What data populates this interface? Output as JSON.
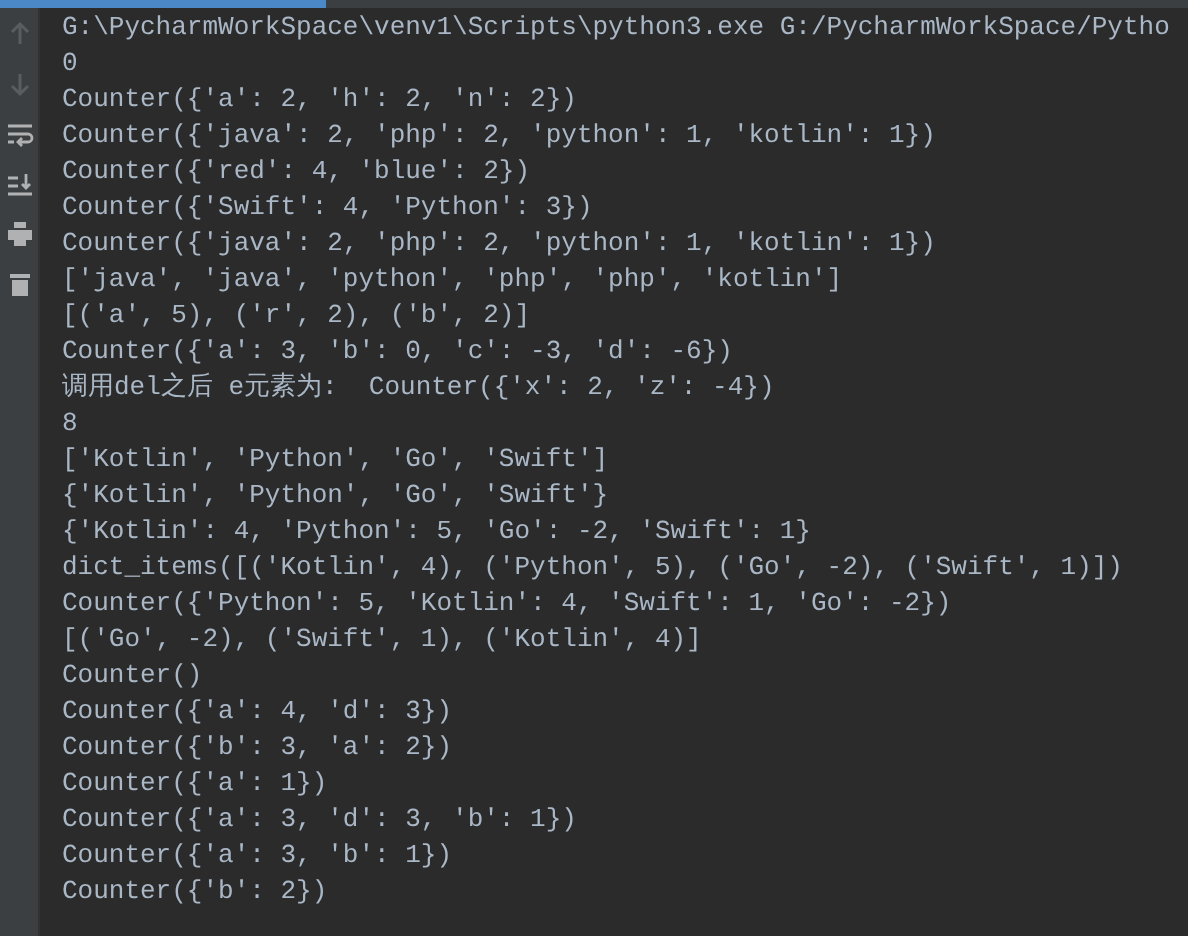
{
  "toolbar": [
    {
      "kind": "up",
      "disabled": true
    },
    {
      "kind": "down",
      "disabled": true
    },
    {
      "kind": "wrap",
      "disabled": false
    },
    {
      "kind": "scroll-end",
      "disabled": false
    },
    {
      "kind": "print",
      "disabled": false
    },
    {
      "kind": "trash",
      "disabled": false
    }
  ],
  "console": {
    "lines": [
      "G:\\PycharmWorkSpace\\venv1\\Scripts\\python3.exe G:/PycharmWorkSpace/Pytho",
      "0",
      "Counter({'a': 2, 'h': 2, 'n': 2})",
      "Counter({'java': 2, 'php': 2, 'python': 1, 'kotlin': 1})",
      "Counter({'red': 4, 'blue': 2})",
      "Counter({'Swift': 4, 'Python': 3})",
      "Counter({'java': 2, 'php': 2, 'python': 1, 'kotlin': 1})",
      "['java', 'java', 'python', 'php', 'php', 'kotlin']",
      "[('a', 5), ('r', 2), ('b', 2)]",
      "Counter({'a': 3, 'b': 0, 'c': -3, 'd': -6})",
      "调用del之后 e元素为:  Counter({'x': 2, 'z': -4})",
      "8",
      "['Kotlin', 'Python', 'Go', 'Swift']",
      "{'Kotlin', 'Python', 'Go', 'Swift'}",
      "{'Kotlin': 4, 'Python': 5, 'Go': -2, 'Swift': 1}",
      "dict_items([('Kotlin', 4), ('Python', 5), ('Go', -2), ('Swift', 1)])",
      "Counter({'Python': 5, 'Kotlin': 4, 'Swift': 1, 'Go': -2})",
      "[('Go', -2), ('Swift', 1), ('Kotlin', 4)]",
      "Counter()",
      "Counter({'a': 4, 'd': 3})",
      "Counter({'b': 3, 'a': 2})",
      "Counter({'a': 1})",
      "Counter({'a': 3, 'd': 3, 'b': 1})",
      "Counter({'a': 3, 'b': 1})",
      "Counter({'b': 2})"
    ]
  }
}
